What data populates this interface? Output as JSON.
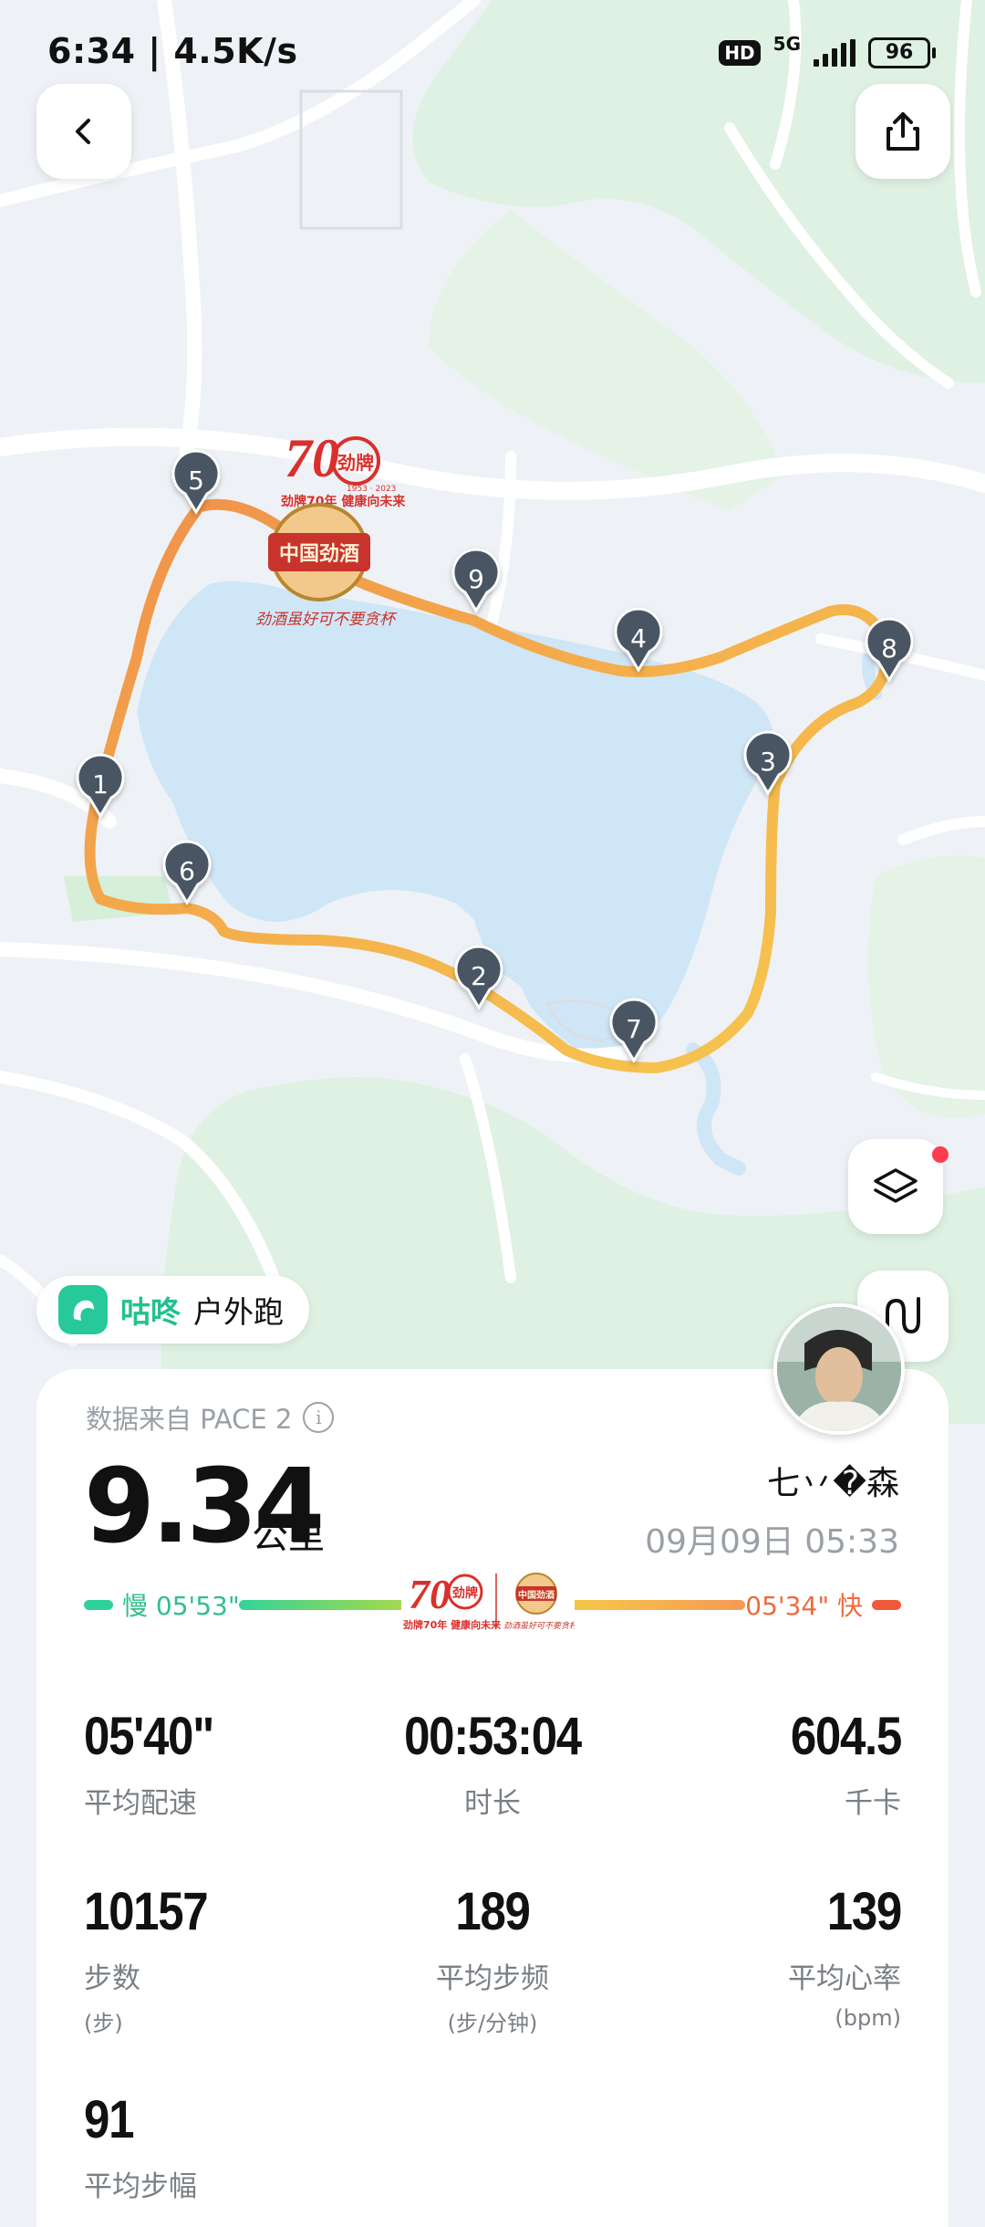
{
  "status_bar": {
    "time": "6:34 | 4.5K/s",
    "hd": "HD",
    "network": "5G",
    "battery": "96"
  },
  "map": {
    "markers": [
      "1",
      "2",
      "3",
      "4",
      "5",
      "6",
      "7",
      "8",
      "9"
    ],
    "sponsor": {
      "number": "70",
      "brand_cn": "劲牌",
      "slogan": "劲牌70年 健康向未来",
      "years": "1953 · 2023",
      "seal": "中国劲酒",
      "tagline": "劲酒虽好可不要贪杯"
    }
  },
  "app": {
    "name": "咕咚",
    "mode": "户外跑"
  },
  "summary": {
    "source": "数据来自 PACE 2",
    "distance": "9.34",
    "distance_unit": "公里",
    "user": "七丷�森",
    "datetime": "09月09日 05:33",
    "pace_slow_label": "慢 05'53\"",
    "pace_fast_label": "05'34\" 快"
  },
  "stats": [
    {
      "value": "05'40\"",
      "label": "平均配速",
      "unit": ""
    },
    {
      "value": "00:53:04",
      "label": "时长",
      "unit": ""
    },
    {
      "value": "604.5",
      "label": "千卡",
      "unit": ""
    },
    {
      "value": "10157",
      "label": "步数",
      "unit": "(步)"
    },
    {
      "value": "189",
      "label": "平均步频",
      "unit": "(步/分钟)"
    },
    {
      "value": "139",
      "label": "平均心率",
      "unit": "(bpm)"
    },
    {
      "value": "91",
      "label": "平均步幅",
      "unit": ""
    }
  ],
  "colors": {
    "accent": "#23c08f",
    "route_start": "#f0904a",
    "route_end": "#f7c24a",
    "marker": "#4a5563",
    "water": "#cfe6f7",
    "park": "#dff1e2"
  }
}
